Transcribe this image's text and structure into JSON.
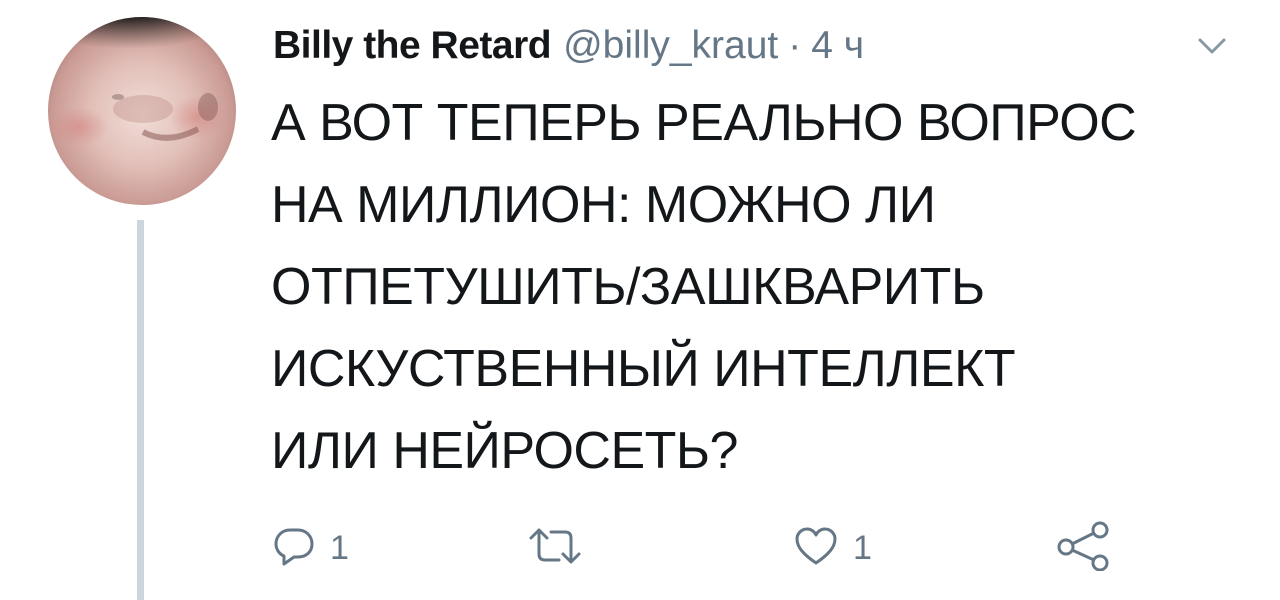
{
  "tweet": {
    "author": {
      "display_name": "Billy the Retard",
      "handle": "@billy_kraut"
    },
    "separator": "·",
    "time": "4 ч",
    "text_lines": [
      "А ВОТ ТЕПЕРЬ РЕАЛЬНО ВОПРОС",
      "НА МИЛЛИОН: МОЖНО ЛИ",
      "ОТПЕТУШИТЬ/ЗАШКВАРИТЬ",
      "ИСКУСТВЕННЫЙ ИНТЕЛЛЕКТ",
      "ИЛИ НЕЙРОСЕТЬ?"
    ],
    "actions": {
      "reply": {
        "icon": "reply-icon",
        "count": "1"
      },
      "retweet": {
        "icon": "retweet-icon",
        "count": ""
      },
      "like": {
        "icon": "heart-icon",
        "count": "1"
      },
      "share": {
        "icon": "share-icon"
      }
    },
    "menu_icon": "chevron-down-icon"
  },
  "colors": {
    "text_primary": "#14171a",
    "text_secondary": "#657786",
    "thread_line": "#ccd6dd",
    "icon_gray": "#657786"
  }
}
